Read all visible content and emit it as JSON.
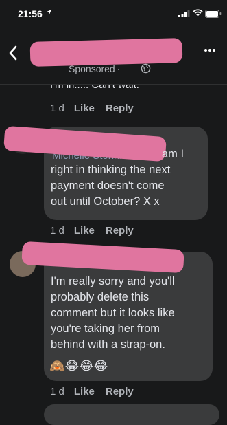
{
  "status": {
    "time": "21:56"
  },
  "header": {
    "sponsored": "Sponsored"
  },
  "comments": [
    {
      "text_cut": "I'm in..... Can't wait.",
      "time": "1 d",
      "like": "Like",
      "reply": "Reply"
    },
    {
      "name_faded": "Michelle Stonhill",
      "text_first": "am I",
      "text_rest": [
        "right in thinking the next",
        "payment doesn't come",
        "out until October? X x"
      ],
      "time": "1 d",
      "like": "Like",
      "reply": "Reply"
    },
    {
      "text": [
        "I'm really sorry and you'll",
        "probably delete this",
        "comment but it looks like",
        "you're taking her from",
        "behind with a strap-on."
      ],
      "emojis": "🙈😂😂😂",
      "time": "1 d",
      "like": "Like",
      "reply": "Reply"
    }
  ],
  "colors": {
    "background": "#18191a",
    "bubble": "#3a3b3c",
    "redaction": "#e0759f",
    "secondary_text": "#b0b3b8"
  }
}
